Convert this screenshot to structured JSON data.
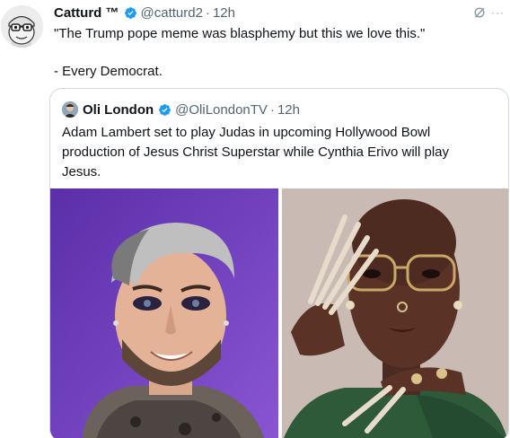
{
  "tweet": {
    "author_name": "Catturd ™",
    "handle": "@catturd2",
    "separator": "·",
    "time": "12h",
    "text_line1": "\"The Trump pope meme was blasphemy but this we love this.\"",
    "text_line2": "- Every Democrat.",
    "icons": [
      "cartoon-avatar-icon",
      "verified-badge-icon",
      "grok-icon",
      "more-icon"
    ],
    "more_glyph": "···"
  },
  "quote": {
    "author_name": "Oli London",
    "handle": "@OliLondonTV",
    "separator": "·",
    "time": "12h",
    "text_lines": [
      "Adam Lambert set to play Judas in upcoming Hollywood Bowl",
      "production of Jesus Christ Superstar while Cynthia Erivo will play",
      "Jesus."
    ],
    "media": [
      "portrait-man-purple-background",
      "portrait-woman-long-nails"
    ]
  },
  "colors": {
    "text": "#0f1419",
    "secondary": "#536471",
    "verified": "#1d9bf0",
    "border": "#cfd9de",
    "left_photo_bg": "#6a3bb3",
    "right_photo_bg": "#c7b8b0"
  }
}
